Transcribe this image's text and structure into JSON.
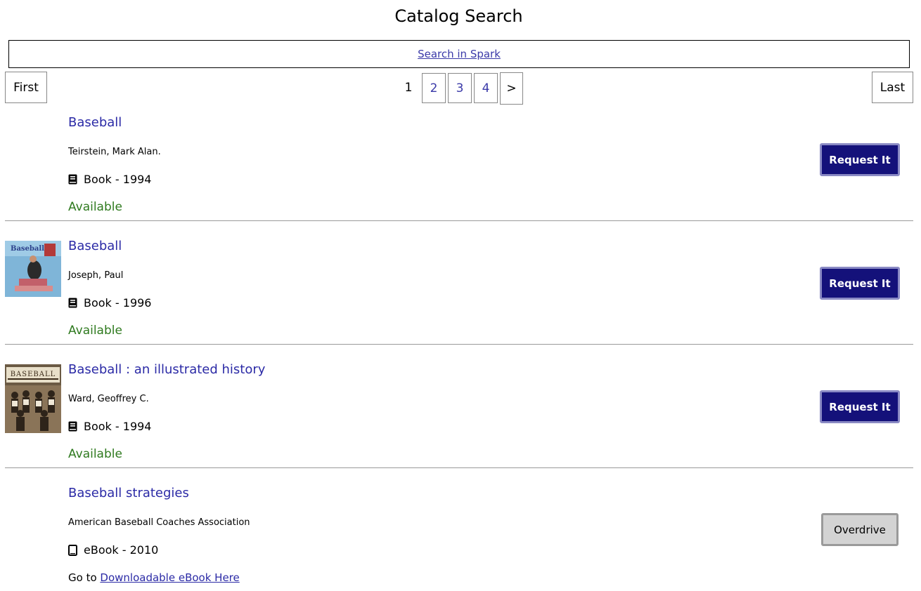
{
  "page": {
    "title": "Catalog Search"
  },
  "spark": {
    "link_label": "Search in Spark"
  },
  "pagination": {
    "first_label": "First",
    "last_label": "Last",
    "current": "1",
    "pages": [
      "2",
      "3",
      "4"
    ],
    "next_label": ">"
  },
  "results": [
    {
      "title": "Baseball",
      "author": "Teirstein, Mark Alan.",
      "format": "Book - 1994",
      "format_icon": "book-icon",
      "status": "Available",
      "action_label": "Request It"
    },
    {
      "title": "Baseball",
      "author": "Joseph, Paul",
      "format": "Book - 1996",
      "format_icon": "book-icon",
      "status": "Available",
      "action_label": "Request It",
      "cover_text": "Baseball"
    },
    {
      "title": "Baseball : an illustrated history",
      "author": "Ward, Geoffrey C.",
      "format": "Book - 1994",
      "format_icon": "book-icon",
      "status": "Available",
      "action_label": "Request It",
      "cover_text": "BASEBALL"
    },
    {
      "title": "Baseball strategies",
      "author": "American Baseball Coaches Association",
      "format": "eBook - 2010",
      "format_icon": "tablet-icon",
      "link_prefix": "Go to ",
      "link_label": "Downloadable eBook Here",
      "action_label": "Overdrive"
    }
  ],
  "colors": {
    "link": "#2b2aa6",
    "available": "#2f7a1f",
    "request_button": "#14117a",
    "overdrive_button": "#d3d3d3"
  }
}
